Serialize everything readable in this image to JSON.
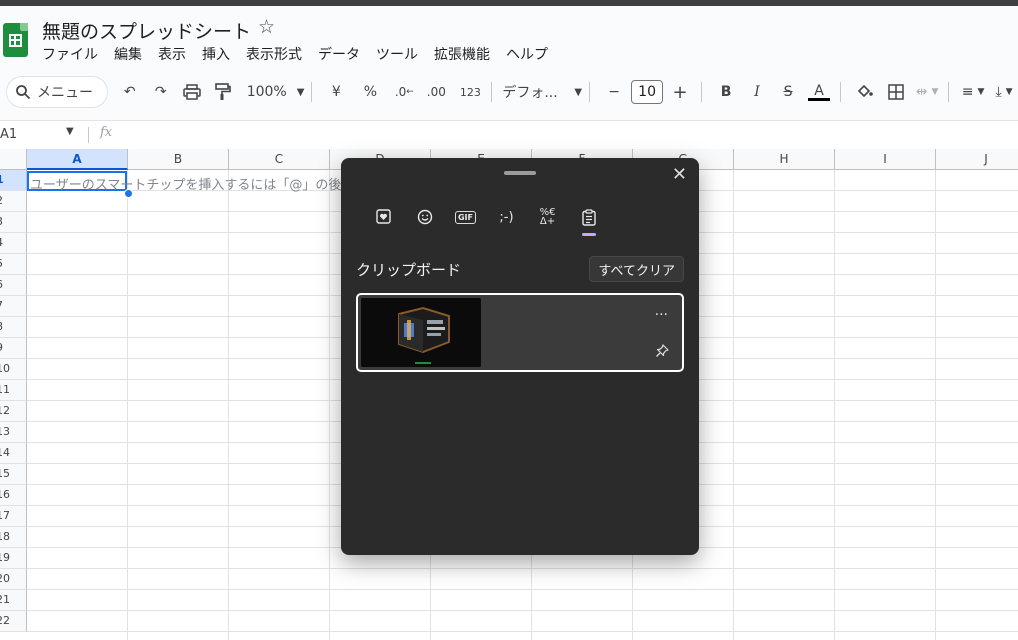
{
  "app": {
    "doc_title": "無題のスプレッドシート",
    "menu": [
      "ファイル",
      "編集",
      "表示",
      "挿入",
      "表示形式",
      "データ",
      "ツール",
      "拡張機能",
      "ヘルプ"
    ]
  },
  "toolbar": {
    "search_label": "メニュー",
    "zoom": "100%",
    "currency": "¥",
    "percent": "%",
    "dec_decrease": ".0",
    "dec_increase": ".00",
    "format_123": "123",
    "font": "デフォ...",
    "font_size": "10",
    "bold": "B",
    "italic": "I",
    "text_color": "A"
  },
  "formula": {
    "namebox": "A1",
    "fx": "fx"
  },
  "sheet": {
    "columns": [
      "A",
      "B",
      "C",
      "D",
      "E",
      "F",
      "G",
      "H",
      "I",
      "J"
    ],
    "rows": [
      "1",
      "2",
      "3",
      "4",
      "5",
      "6",
      "7",
      "8",
      "9",
      "10",
      "11",
      "12",
      "13",
      "14",
      "15",
      "16",
      "17",
      "18",
      "19",
      "20",
      "21",
      "22"
    ],
    "cell_hint": "ユーザーのスマートチップを挿入するには「@」の後"
  },
  "clipboard_panel": {
    "title": "クリップボード",
    "clear_all": "すべてクリア",
    "more": "..."
  },
  "colors": {
    "accent": "#0b57d0",
    "selection": "#1a73e8",
    "panel_bg": "#2b2b2b",
    "active_tab": "#c7a6ff"
  }
}
